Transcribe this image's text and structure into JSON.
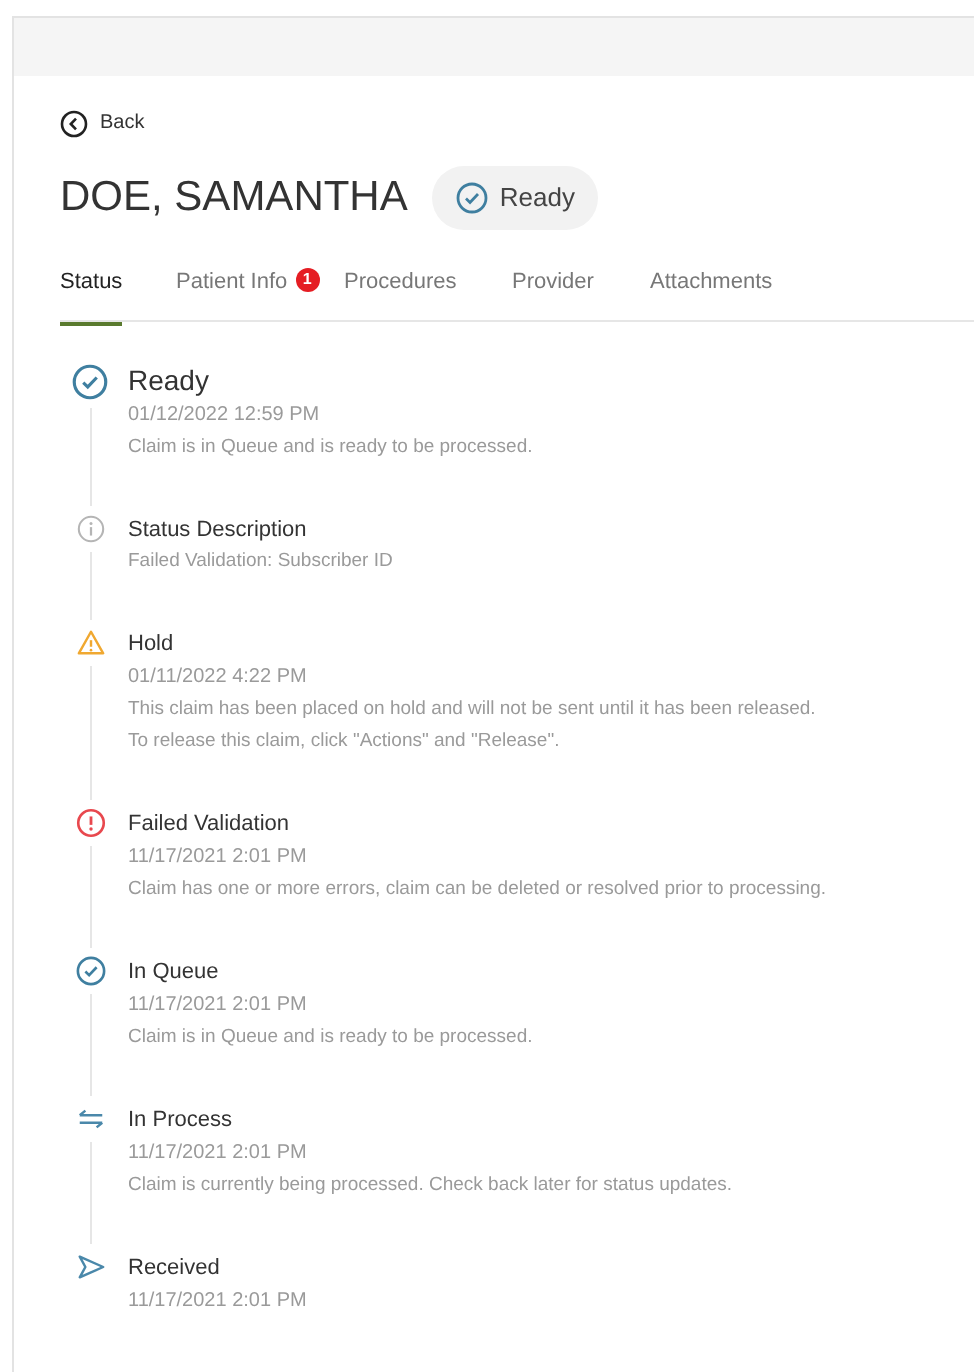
{
  "back": {
    "label": "Back"
  },
  "patient": {
    "name": "DOE, SAMANTHA",
    "status": "Ready"
  },
  "tabs": [
    {
      "label": "Status",
      "selected": true
    },
    {
      "label": "Patient Info",
      "selected": false,
      "badge": "1"
    },
    {
      "label": "Procedures",
      "selected": false
    },
    {
      "label": "Provider",
      "selected": false
    },
    {
      "label": "Attachments",
      "selected": false
    }
  ],
  "timeline": [
    {
      "kind": "check",
      "current": true,
      "title": "Ready",
      "date": "01/12/2022 12:59 PM",
      "lines": [
        "Claim is in Queue and is ready to be processed."
      ]
    },
    {
      "kind": "info",
      "current": false,
      "title": "Status Description",
      "lines": [
        "Failed Validation: Subscriber ID"
      ]
    },
    {
      "kind": "warning",
      "current": false,
      "title": "Hold",
      "date": "01/11/2022 4:22 PM",
      "lines": [
        "This claim has been placed on hold and will not be sent until it has been released.",
        "To release this claim, click \"Actions\" and \"Release\"."
      ]
    },
    {
      "kind": "error",
      "current": false,
      "title": "Failed Validation",
      "date": "11/17/2021 2:01 PM",
      "lines": [
        "Claim has one or more errors, claim can be deleted or resolved prior to processing."
      ]
    },
    {
      "kind": "check",
      "current": false,
      "title": "In Queue",
      "date": "11/17/2021 2:01 PM",
      "lines": [
        "Claim is in Queue and is ready to be processed."
      ]
    },
    {
      "kind": "transfer",
      "current": false,
      "title": "In Process",
      "date": "11/17/2021 2:01 PM",
      "lines": [
        "Claim is currently being processed. Check back later for status updates."
      ]
    },
    {
      "kind": "send",
      "current": false,
      "title": "Received",
      "date": "11/17/2021 2:01 PM"
    }
  ]
}
